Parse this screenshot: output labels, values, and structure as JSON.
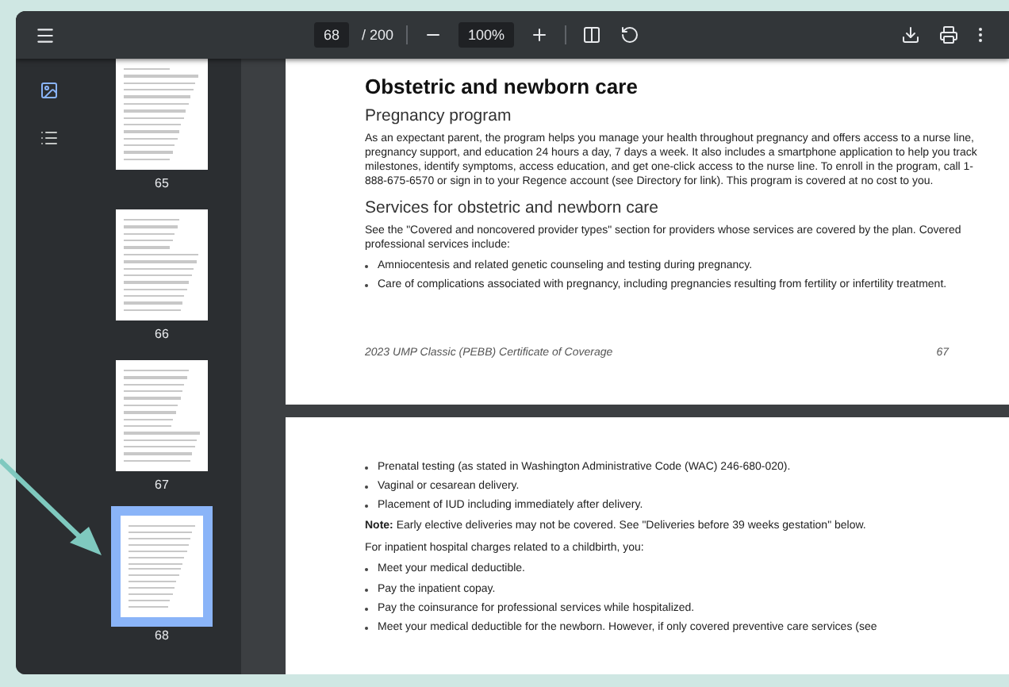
{
  "toolbar": {
    "page_number": "68",
    "page_total": "/ 200",
    "zoom": "100%"
  },
  "sidebar": {
    "tabs": [
      {
        "kind": "thumbnails",
        "selected": true
      },
      {
        "kind": "outline",
        "selected": false
      }
    ],
    "thumbnails": [
      {
        "label": "65",
        "selected": false
      },
      {
        "label": "66",
        "selected": false
      },
      {
        "label": "67",
        "selected": false
      },
      {
        "label": "68",
        "selected": true
      }
    ]
  },
  "pages": [
    {
      "blocks": [
        {
          "kind": "heading",
          "text": "Obstetric and newborn care"
        },
        {
          "kind": "subheading",
          "text": "Pregnancy program"
        },
        {
          "kind": "paragraph",
          "text": "As an expectant parent, the program helps you manage your health throughout pregnancy and offers access to a nurse line, pregnancy support, and education 24 hours a day, 7 days a week. It also includes a smartphone application to help you track milestones, identify symptoms, access education, and get one-click access to the nurse line. To enroll in the program, call 1-888-675-6570 or sign in to your Regence account (see Directory for link). This program is covered at no cost to you."
        },
        {
          "kind": "subheading",
          "text": "Services for obstetric and newborn care"
        },
        {
          "kind": "paragraph",
          "text": "See the \"Covered and noncovered provider types\" section for providers whose services are covered by the plan. Covered professional services include:"
        },
        {
          "kind": "bullet",
          "text": "Amniocentesis and related genetic counseling and testing during pregnancy."
        },
        {
          "kind": "bullet",
          "text": "Care of complications associated with pregnancy, including pregnancies resulting from fertility or infertility treatment."
        }
      ],
      "footer": {
        "title": "2023 UMP Classic (PEBB) Certificate of Coverage",
        "page": "67"
      }
    },
    {
      "blocks": [
        {
          "kind": "bullet",
          "text": "Prenatal testing (as stated in Washington Administrative Code (WAC) 246-680-020)."
        },
        {
          "kind": "bullet",
          "text": "Vaginal or cesarean delivery."
        },
        {
          "kind": "bullet",
          "text": "Placement of IUD including immediately after delivery."
        },
        {
          "kind": "paragraph",
          "text": "**Note:** Early elective deliveries may not be covered. See \"Deliveries before 39 weeks gestation\" below."
        },
        {
          "kind": "paragraph",
          "text": "For inpatient hospital charges related to a childbirth, you:"
        },
        {
          "kind": "bullet",
          "text": "Meet your medical deductible."
        },
        {
          "kind": "bullet",
          "text": "Pay the inpatient copay."
        },
        {
          "kind": "bullet",
          "text": "Pay the coinsurance for professional services while hospitalized."
        },
        {
          "kind": "bullet",
          "text": "Meet your medical deductible for the newborn. However, if only covered preventive care services (see"
        }
      ]
    }
  ]
}
